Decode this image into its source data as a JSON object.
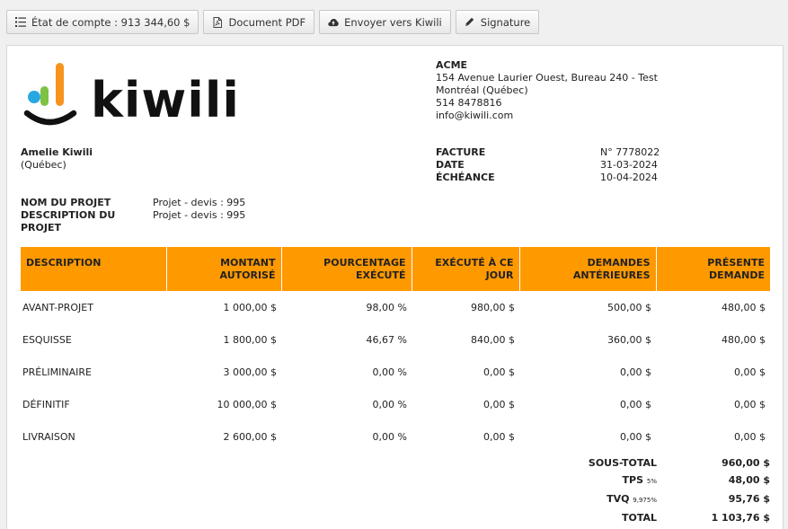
{
  "toolbar": {
    "account_statement": "État de compte : 913 344,60 $",
    "pdf": "Document PDF",
    "send": "Envoyer vers Kiwili",
    "signature": "Signature"
  },
  "brand": {
    "wordmark": "kiwili",
    "colors": {
      "blue": "#29a8e0",
      "green": "#7dc242",
      "orange": "#f7941d",
      "header": "#ff9900"
    }
  },
  "company": {
    "name": "ACME",
    "address": "154 Avenue Laurier Ouest, Bureau 240 - Test",
    "city": "Montréal (Québec)",
    "phone": "514 8478816",
    "email": "info@kiwili.com"
  },
  "client": {
    "name": "Amelie Kiwili",
    "region": "(Québec)"
  },
  "invoice": {
    "number_label": "FACTURE",
    "number": "N° 7778022",
    "date_label": "DATE",
    "date": "31-03-2024",
    "due_label": "ÉCHÉANCE",
    "due": "10-04-2024"
  },
  "project": {
    "name_label": "NOM DU PROJET",
    "name": "Projet - devis : 995",
    "desc_label": "DESCRIPTION DU PROJET",
    "desc": "Projet - devis : 995"
  },
  "table": {
    "headers": [
      [
        "DESCRIPTION",
        ""
      ],
      [
        "MONTANT",
        "AUTORISÉ"
      ],
      [
        "POURCENTAGE",
        "EXÉCUTÉ"
      ],
      [
        "EXÉCUTÉ À CE",
        "JOUR"
      ],
      [
        "DEMANDES",
        "ANTÉRIEURES"
      ],
      [
        "PRÉSENTE",
        "DEMANDE"
      ]
    ],
    "rows": [
      [
        "AVANT-PROJET",
        "1 000,00 $",
        "98,00 %",
        "980,00 $",
        "500,00 $",
        "480,00 $"
      ],
      [
        "ESQUISSE",
        "1 800,00 $",
        "46,67 %",
        "840,00 $",
        "360,00 $",
        "480,00 $"
      ],
      [
        "PRÉLIMINAIRE",
        "3 000,00 $",
        "0,00 %",
        "0,00 $",
        "0,00 $",
        "0,00 $"
      ],
      [
        "DÉFINITIF",
        "10 000,00 $",
        "0,00 %",
        "0,00 $",
        "0,00 $",
        "0,00 $"
      ],
      [
        "LIVRAISON",
        "2 600,00 $",
        "0,00 %",
        "0,00 $",
        "0,00 $",
        "0,00 $"
      ]
    ]
  },
  "totals": {
    "subtotal_label": "SOUS-TOTAL",
    "subtotal": "960,00 $",
    "tps_label": "TPS",
    "tps_rate": "5%",
    "tps": "48,00 $",
    "tvq_label": "TVQ",
    "tvq_rate": "9,975%",
    "tvq": "95,76 $",
    "total_label": "TOTAL",
    "total": "1 103,76 $"
  }
}
